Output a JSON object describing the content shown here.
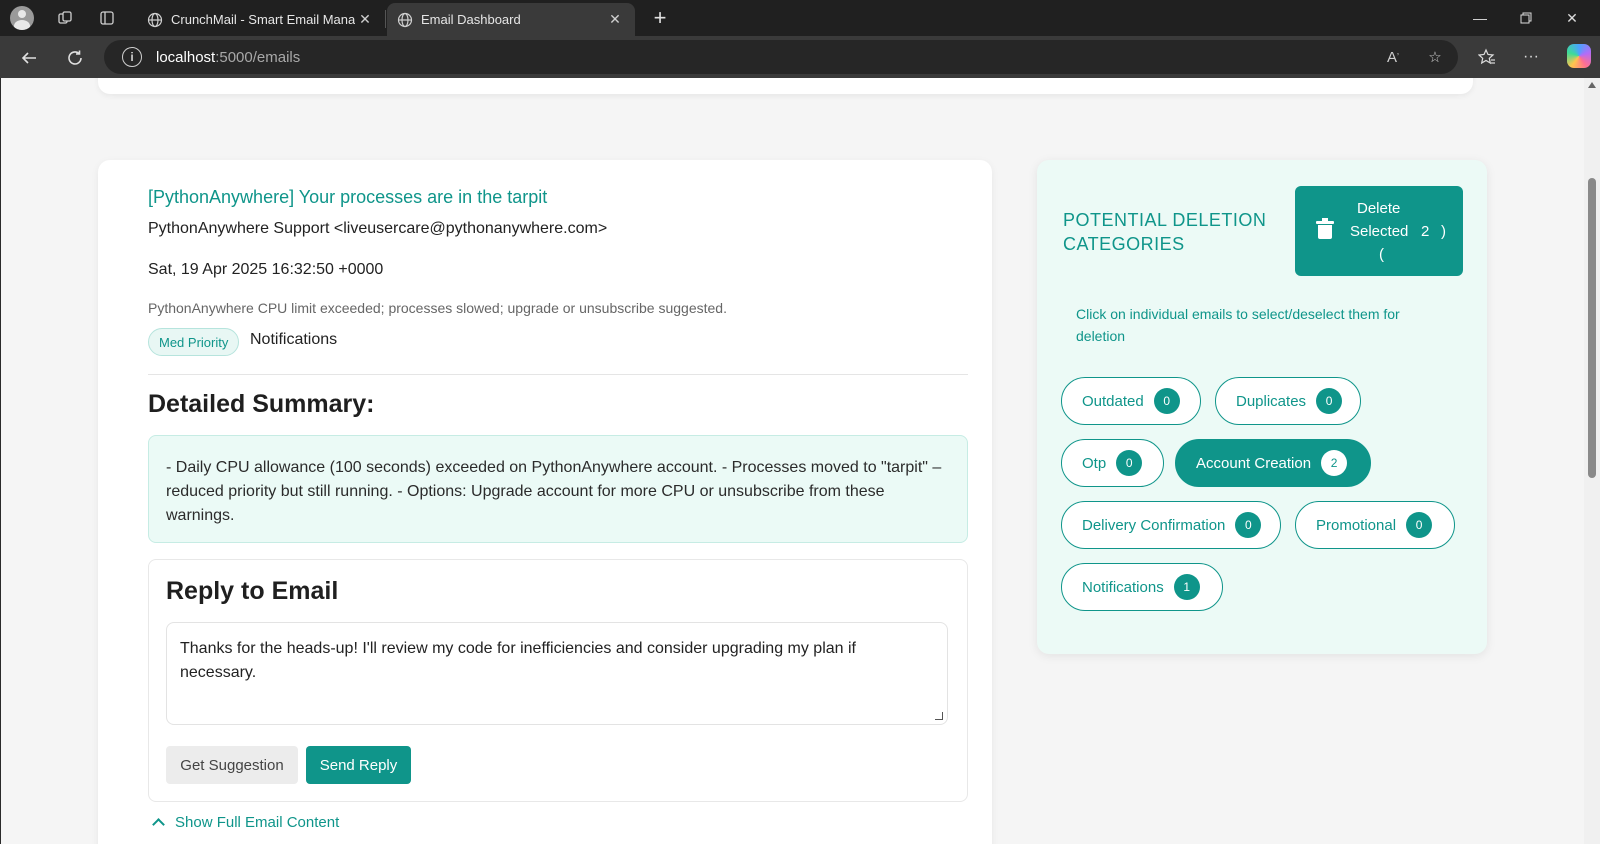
{
  "browser": {
    "tabs": [
      {
        "title": "CrunchMail - Smart Email Manag",
        "active": false
      },
      {
        "title": "Email Dashboard",
        "active": true
      }
    ],
    "url_host": "localhost",
    "url_path": ":5000/emails"
  },
  "email": {
    "subject": "[PythonAnywhere] Your processes are in the tarpit",
    "sender": "PythonAnywhere Support <liveusercare@pythonanywhere.com>",
    "date": "Sat, 19 Apr 2025 16:32:50 +0000",
    "snippet": "PythonAnywhere CPU limit exceeded; processes slowed; upgrade or unsubscribe suggested.",
    "priority": "Med Priority",
    "category": "Notifications",
    "summary_heading": "Detailed Summary:",
    "summary": "- Daily CPU allowance (100 seconds) exceeded on PythonAnywhere account. - Processes moved to \"tarpit\" – reduced priority but still running. - Options: Upgrade account for more CPU or unsubscribe from these warnings.",
    "show_full": "Show Full Email Content"
  },
  "reply": {
    "heading": "Reply to Email",
    "text": "Thanks for the heads-up! I'll review my code for inefficiencies and consider upgrading my plan if necessary.",
    "suggest_label": "Get Suggestion",
    "send_label": "Send Reply"
  },
  "deletion": {
    "title": "POTENTIAL DELETION CATEGORIES",
    "delete_label_1": "Delete",
    "delete_label_2": "Selected",
    "delete_count": "2",
    "delete_paren_close": ")",
    "delete_paren_open": "(",
    "hint": "Click on individual emails to select/deselect them for deletion",
    "categories": [
      {
        "label": "Outdated",
        "count": "0"
      },
      {
        "label": "Duplicates",
        "count": "0"
      },
      {
        "label": "Otp",
        "count": "0"
      },
      {
        "label": "Account Creation",
        "count": "2"
      },
      {
        "label": "Delivery Confirmation",
        "count": "0"
      },
      {
        "label": "Promotional",
        "count": "0"
      },
      {
        "label": "Notifications",
        "count": "1"
      }
    ]
  },
  "colors": {
    "accent": "#0f958a",
    "panel_bg": "#ecfaf6"
  },
  "icons": [
    "profile-icon",
    "workspaces-icon",
    "vertical-tabs-icon",
    "globe-icon",
    "close-icon",
    "new-tab-icon",
    "minimize-icon",
    "restore-icon",
    "back-icon",
    "refresh-icon",
    "info-icon",
    "read-aloud-icon",
    "favorite-star-icon",
    "favorites-icon",
    "more-icon",
    "copilot-icon",
    "trash-icon",
    "chevron-up-icon"
  ]
}
